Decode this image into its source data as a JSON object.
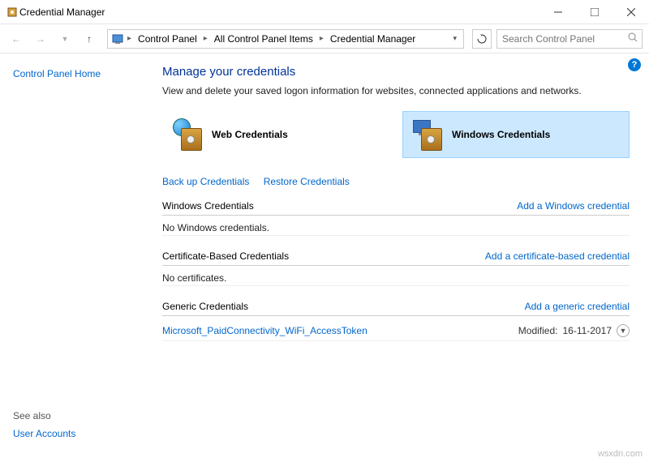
{
  "window": {
    "title": "Credential Manager"
  },
  "breadcrumb": {
    "items": [
      "Control Panel",
      "All Control Panel Items",
      "Credential Manager"
    ]
  },
  "search": {
    "placeholder": "Search Control Panel"
  },
  "sidebar": {
    "home": "Control Panel Home",
    "seealso_label": "See also",
    "seealso_link": "User Accounts"
  },
  "page": {
    "title": "Manage your credentials",
    "subtitle": "View and delete your saved logon information for websites, connected applications and networks."
  },
  "credtypes": {
    "web": "Web Credentials",
    "windows": "Windows Credentials"
  },
  "links": {
    "backup": "Back up Credentials",
    "restore": "Restore Credentials"
  },
  "sections": {
    "windows": {
      "title": "Windows Credentials",
      "add": "Add a Windows credential",
      "empty": "No Windows credentials."
    },
    "cert": {
      "title": "Certificate-Based Credentials",
      "add": "Add a certificate-based credential",
      "empty": "No certificates."
    },
    "generic": {
      "title": "Generic Credentials",
      "add": "Add a generic credential",
      "item_name": "Microsoft_PaidConnectivity_WiFi_AccessToken",
      "item_modified_label": "Modified:",
      "item_modified_date": "16-11-2017"
    }
  },
  "watermark": "wsxdn.com"
}
